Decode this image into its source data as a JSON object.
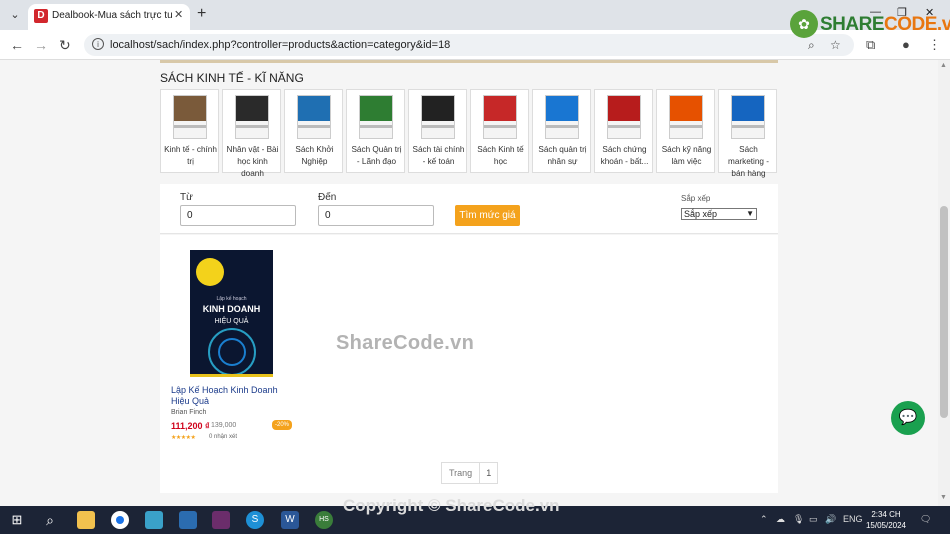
{
  "browser": {
    "tab_title": "Dealbook-Mua sách trực tuyến",
    "url": "localhost/sach/index.php?controller=products&action=category&id=18",
    "favicon_letter": "D"
  },
  "logo": {
    "prefix": "SHARE",
    "suffix": "CODE.vn"
  },
  "page": {
    "heading": "SÁCH KINH TẾ - KĨ NĂNG",
    "categories": [
      {
        "label": "Kinh tế - chính trị",
        "color": "#7a5a3a"
      },
      {
        "label": "Nhân vật - Bài học kinh doanh",
        "color": "#2a2a2a"
      },
      {
        "label": "Sách Khởi Nghiệp",
        "color": "#1f6fb2"
      },
      {
        "label": "Sách Quản trị - Lãnh đạo",
        "color": "#2e7d32"
      },
      {
        "label": "Sách tài chính - kế toán",
        "color": "#222222"
      },
      {
        "label": "Sách Kinh tế học",
        "color": "#c62828"
      },
      {
        "label": "Sách quản trị nhân sự",
        "color": "#1976d2"
      },
      {
        "label": "Sách chứng khoán - bất...",
        "color": "#b71c1c"
      },
      {
        "label": "Sách kỹ năng làm việc",
        "color": "#e65100"
      },
      {
        "label": "Sách marketing - bán hàng",
        "color": "#1565c0"
      }
    ],
    "filter": {
      "from_label": "Từ",
      "from_value": "0",
      "to_label": "Đến",
      "to_value": "0",
      "button": "Tìm mức giá",
      "sort_label": "Sắp xếp",
      "sort_value": "Sắp xếp"
    },
    "products": [
      {
        "cover_small": "Lập kế hoạch",
        "cover_title": "KINH DOANH",
        "cover_subtitle": "HIỆU QUẢ",
        "name": "Lập Kế Hoạch Kinh Doanh Hiệu Quả",
        "author": "Brian Finch",
        "price": "111,200 ₫",
        "old_price": "139,000",
        "discount": "-20%",
        "stars": "★★★★★",
        "reviews": "0 nhận xét"
      }
    ],
    "pagination": {
      "label": "Trang",
      "current": "1"
    },
    "watermark": "ShareCode.vn",
    "copyright": "Copyright © ShareCode.vn"
  },
  "taskbar": {
    "language": "ENG",
    "time": "2:34 CH",
    "date": "15/05/2024"
  }
}
